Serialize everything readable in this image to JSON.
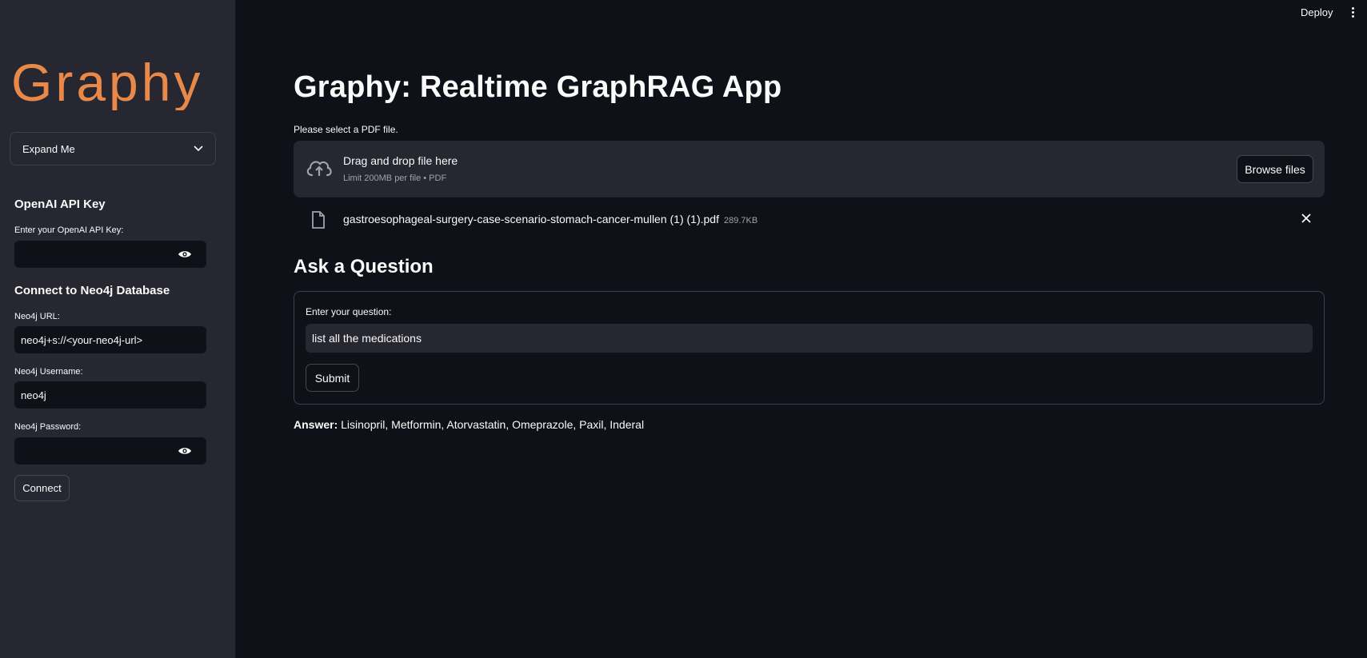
{
  "header": {
    "deploy_label": "Deploy",
    "menu_icon": "kebab-menu-icon"
  },
  "sidebar": {
    "logo_text": "Graphy",
    "logo_color": "#e8894a",
    "expander_label": "Expand Me",
    "openai_section_title": "OpenAI API Key",
    "openai_key_label": "Enter your OpenAI API Key:",
    "openai_key_value": "",
    "neo4j_section_title": "Connect to Neo4j Database",
    "neo4j_url_label": "Neo4j URL:",
    "neo4j_url_value": "neo4j+s://<your-neo4j-url>",
    "neo4j_username_label": "Neo4j Username:",
    "neo4j_username_value": "neo4j",
    "neo4j_password_label": "Neo4j Password:",
    "neo4j_password_value": "",
    "connect_label": "Connect"
  },
  "main": {
    "title": "Graphy: Realtime GraphRAG App",
    "uploader_label": "Please select a PDF file.",
    "dropzone_title": "Drag and drop file here",
    "dropzone_subtitle": "Limit 200MB per file • PDF",
    "browse_label": "Browse files",
    "file_name": "gastroesophageal-surgery-case-scenario-stomach-cancer-mullen (1) (1).pdf",
    "file_size": "289.7KB",
    "question_heading": "Ask a Question",
    "question_label": "Enter your question:",
    "question_value": "list all the medications",
    "submit_label": "Submit",
    "answer_label": "Answer:",
    "answer_text": "Lisinopril, Metformin, Atorvastatin, Omeprazole, Paxil, Inderal"
  }
}
